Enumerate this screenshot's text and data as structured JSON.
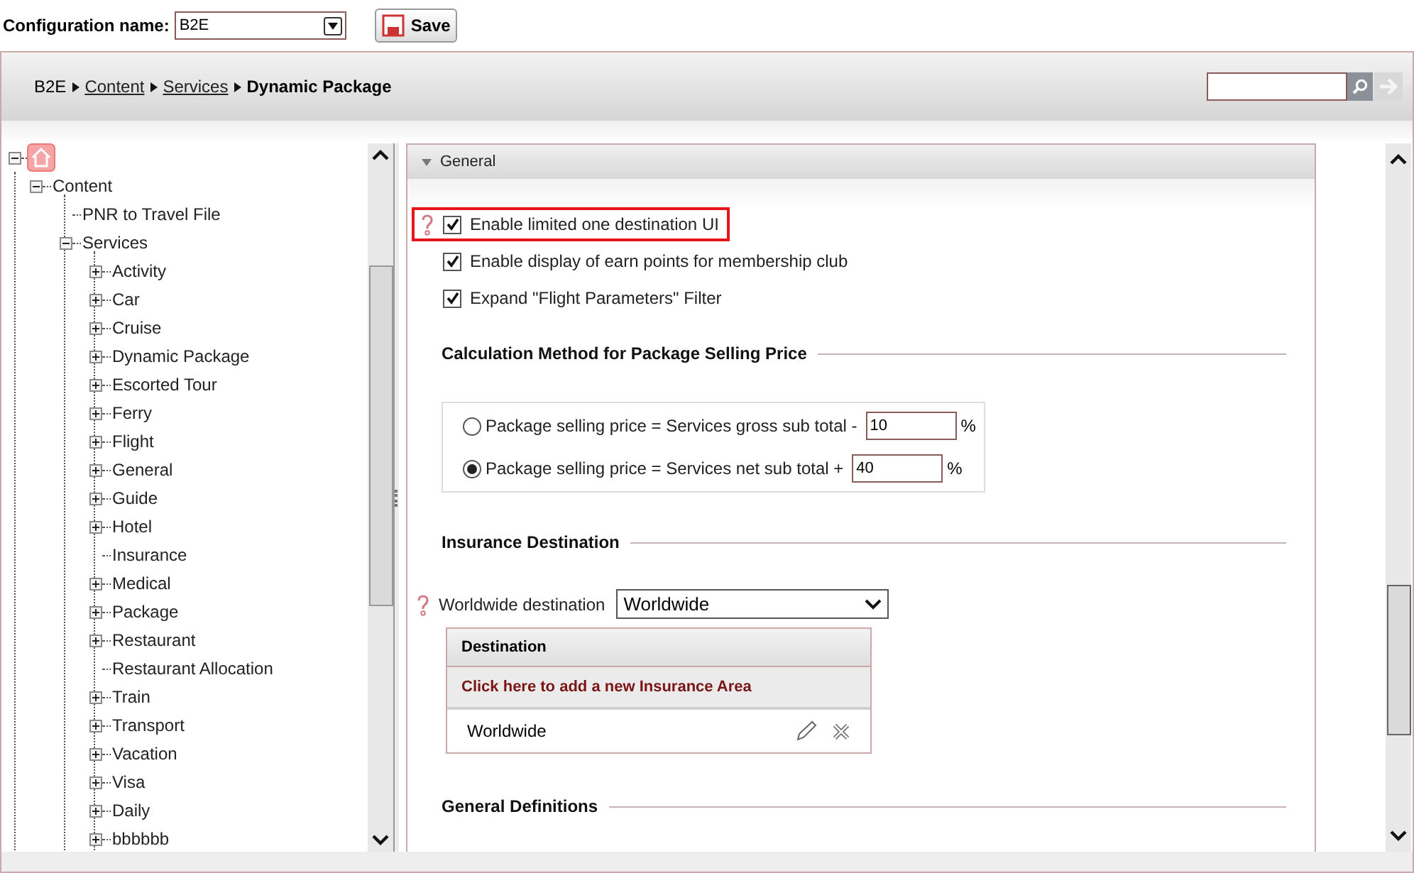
{
  "config": {
    "label": "Configuration name:",
    "value": "B2E",
    "save": "Save"
  },
  "breadcrumb": [
    {
      "text": "B2E",
      "kind": "plain"
    },
    {
      "text": "Content",
      "kind": "link"
    },
    {
      "text": "Services",
      "kind": "link"
    },
    {
      "text": "Dynamic Package",
      "kind": "current"
    }
  ],
  "tree": {
    "expanded": true,
    "children": [
      {
        "label": "Content",
        "kind": "node",
        "expanded": true,
        "children": [
          {
            "label": "PNR to Travel File",
            "kind": "leaf"
          },
          {
            "label": "Services",
            "kind": "node",
            "expanded": true,
            "children": [
              {
                "label": "Activity",
                "kind": "node",
                "expanded": false
              },
              {
                "label": "Car",
                "kind": "node",
                "expanded": false
              },
              {
                "label": "Cruise",
                "kind": "node",
                "expanded": false
              },
              {
                "label": "Dynamic Package",
                "kind": "node",
                "expanded": false
              },
              {
                "label": "Escorted Tour",
                "kind": "node",
                "expanded": false
              },
              {
                "label": "Ferry",
                "kind": "node",
                "expanded": false
              },
              {
                "label": "Flight",
                "kind": "node",
                "expanded": false
              },
              {
                "label": "General",
                "kind": "node",
                "expanded": false
              },
              {
                "label": "Guide",
                "kind": "node",
                "expanded": false
              },
              {
                "label": "Hotel",
                "kind": "node",
                "expanded": false
              },
              {
                "label": "Insurance",
                "kind": "leaf"
              },
              {
                "label": "Medical",
                "kind": "node",
                "expanded": false
              },
              {
                "label": "Package",
                "kind": "node",
                "expanded": false
              },
              {
                "label": "Restaurant",
                "kind": "node",
                "expanded": false
              },
              {
                "label": "Restaurant Allocation",
                "kind": "leaf"
              },
              {
                "label": "Train",
                "kind": "node",
                "expanded": false
              },
              {
                "label": "Transport",
                "kind": "node",
                "expanded": false
              },
              {
                "label": "Vacation",
                "kind": "node",
                "expanded": false
              },
              {
                "label": "Visa",
                "kind": "node",
                "expanded": false
              },
              {
                "label": "Daily",
                "kind": "node",
                "expanded": false
              },
              {
                "label": "bbbbbb",
                "kind": "node",
                "expanded": false
              }
            ]
          }
        ]
      }
    ]
  },
  "section": {
    "title": "General",
    "expanded": true
  },
  "options": [
    {
      "label": "Enable limited one destination UI",
      "checked": true,
      "highlighted": true,
      "help": true
    },
    {
      "label": "Enable display of earn points for membership club",
      "checked": true,
      "highlighted": false,
      "help": false
    },
    {
      "label": "Expand \"Flight Parameters\" Filter",
      "checked": true,
      "highlighted": false,
      "help": false
    }
  ],
  "calc": {
    "title": "Calculation Method for Package Selling Price",
    "methods": [
      {
        "label": "Package selling price = Services gross sub total -",
        "value": "10",
        "unit": "%",
        "selected": false
      },
      {
        "label": "Package selling price = Services net sub total +",
        "value": "40",
        "unit": "%",
        "selected": true
      }
    ]
  },
  "insurance": {
    "title": "Insurance Destination",
    "field_label": "Worldwide destination",
    "field_value": "Worldwide",
    "column": "Destination",
    "add_link": "Click here to add a new Insurance Area",
    "rows": [
      "Worldwide"
    ]
  },
  "general_definitions": {
    "title": "General Definitions"
  }
}
